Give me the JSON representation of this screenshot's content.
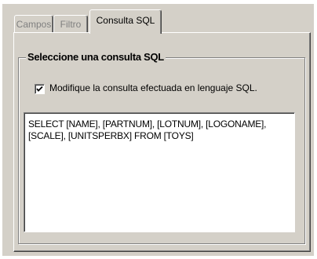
{
  "tabs": [
    {
      "label": "Campos",
      "active": false
    },
    {
      "label": "Filtro",
      "active": false
    },
    {
      "label": "Consulta SQL",
      "active": true
    }
  ],
  "group": {
    "title": "Seleccione una consulta SQL"
  },
  "checkbox": {
    "checked": true,
    "label": "Modifique la consulta efectuada en lenguaje SQL."
  },
  "sql_text": "SELECT [NAME], [PARTNUM], [LOTNUM], [LOGONAME],\n[SCALE], [UNITSPERBX] FROM [TOYS]",
  "colors": {
    "face": "#d4d0c8",
    "highlight": "#ffffff",
    "shadow": "#808080",
    "dark_shadow": "#404040",
    "disabled_text": "#808080"
  }
}
